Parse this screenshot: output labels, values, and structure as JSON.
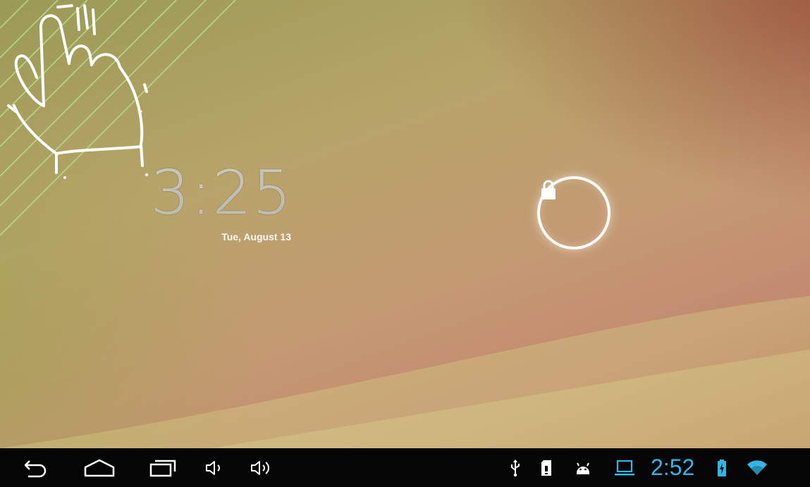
{
  "lockscreen": {
    "time": "3:25",
    "date": "Tue, August 13"
  },
  "icons": {
    "lock": "lock-icon",
    "gesture_hint": "hand-swipe-icon",
    "back": "back-icon",
    "home": "home-icon",
    "recent_apps": "recent-apps-icon",
    "volume_down": "volume-down-icon",
    "volume_up": "volume-up-icon",
    "usb": "usb-icon",
    "sd_card": "sd-card-icon",
    "android_debug": "android-debug-icon",
    "screen_cast": "laptop-icon",
    "battery": "battery-charging-icon",
    "wifi": "wifi-icon"
  },
  "status_bar": {
    "time": "2:52"
  },
  "colors": {
    "status_accent": "#33b5e5",
    "navbar_bg": "#050505",
    "icon_white": "#ffffff"
  }
}
